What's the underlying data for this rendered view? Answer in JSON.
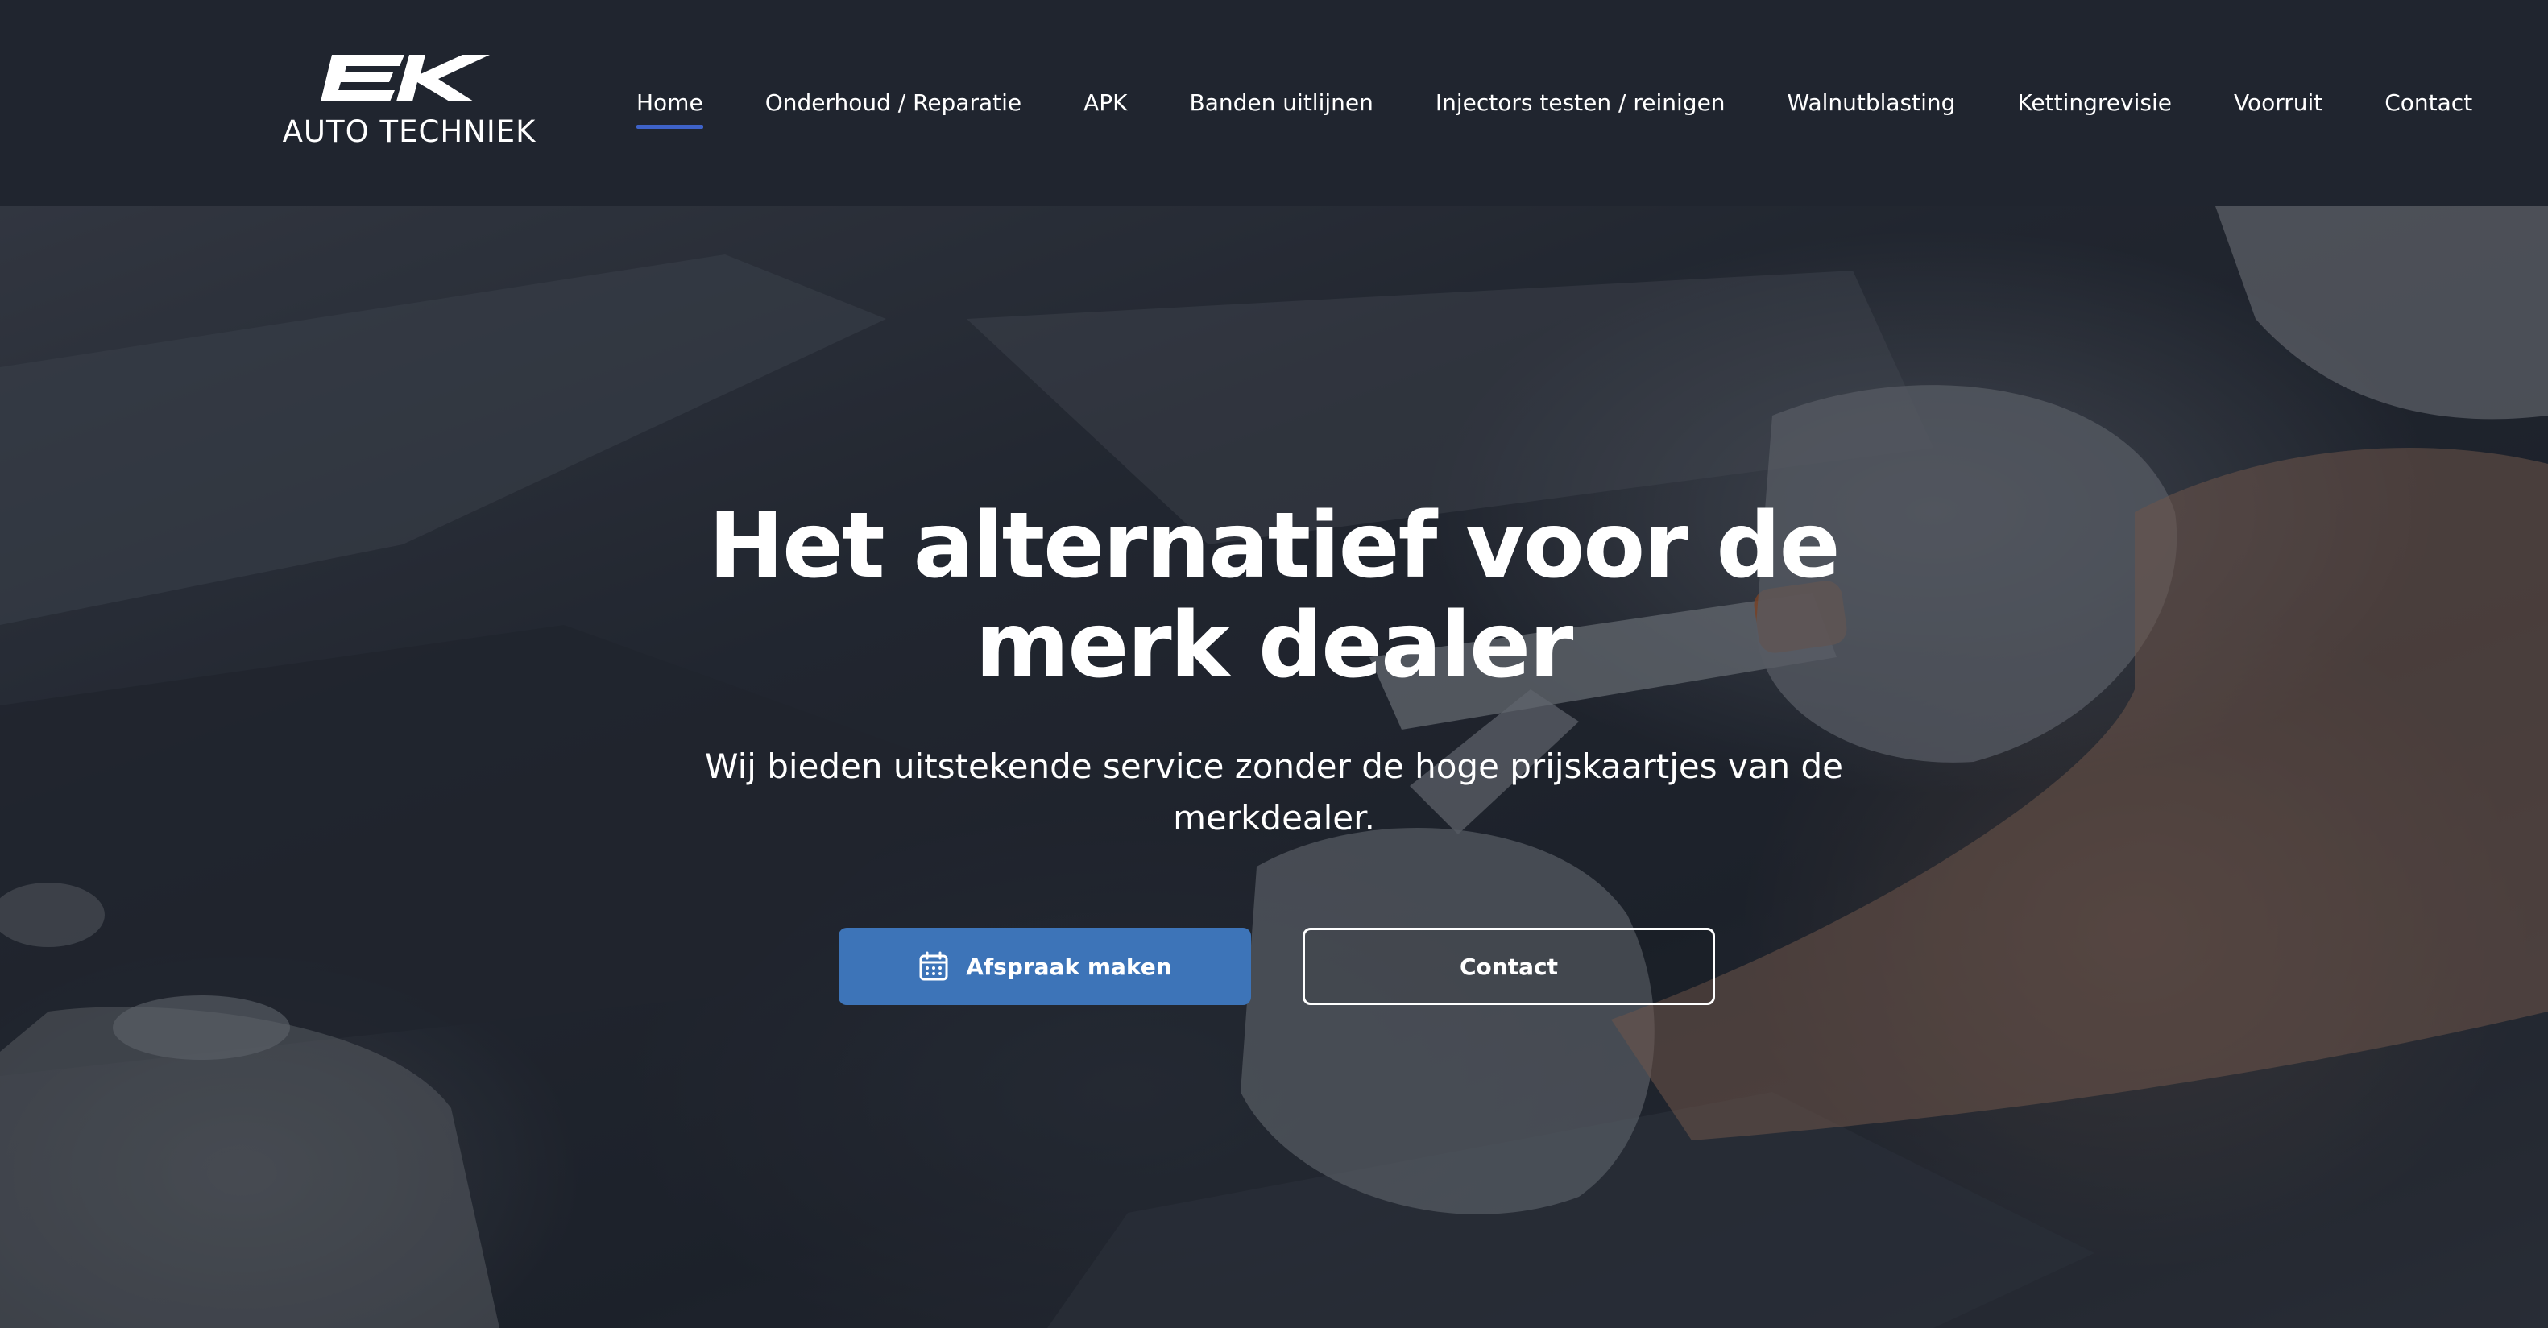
{
  "header": {
    "logo": {
      "mark": "EK",
      "subtitle": "AUTO TECHNIEK"
    },
    "nav": [
      {
        "label": "Home",
        "active": true
      },
      {
        "label": "Onderhoud / Reparatie",
        "active": false
      },
      {
        "label": "APK",
        "active": false
      },
      {
        "label": "Banden uitlijnen",
        "active": false
      },
      {
        "label": "Injectors testen / reinigen",
        "active": false
      },
      {
        "label": "Walnutblasting",
        "active": false
      },
      {
        "label": "Kettingrevisie",
        "active": false
      },
      {
        "label": "Voorruit",
        "active": false
      },
      {
        "label": "Contact",
        "active": false
      }
    ]
  },
  "hero": {
    "title": "Het alternatief voor de merk dealer",
    "subtitle": "Wij bieden uitstekende service zonder de hoge prijskaartjes van de merkdealer.",
    "primary_button": {
      "label": "Afspraak maken",
      "icon": "calendar-icon"
    },
    "secondary_button": {
      "label": "Contact"
    }
  },
  "colors": {
    "header_bg": "#20252f",
    "accent": "#3e62c8",
    "primary_button": "#3d74b8"
  }
}
